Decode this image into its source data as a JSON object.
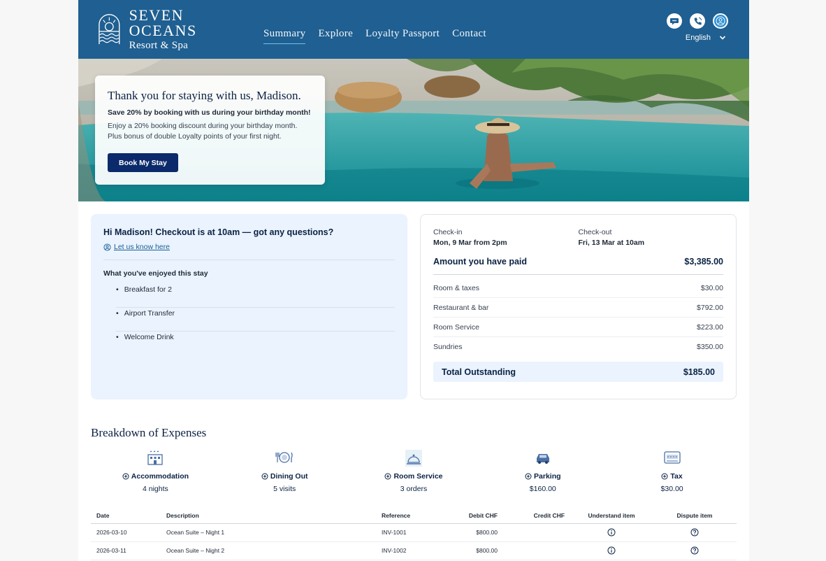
{
  "brand": {
    "name": "SEVEN OCEANS",
    "tagline": "Resort & Spa"
  },
  "nav": {
    "items": [
      {
        "label": "Summary",
        "active": true
      },
      {
        "label": "Explore"
      },
      {
        "label": "Loyalty Passport"
      },
      {
        "label": "Contact"
      }
    ]
  },
  "header": {
    "icons": [
      "chat-icon",
      "phone-icon",
      "account-icon"
    ],
    "language": "English"
  },
  "hero": {
    "title": "Thank you for staying with us, Madison.",
    "promo": "Save 20% by booking with us during your birthday month!",
    "desc_line1": "Enjoy a 20% booking discount during your birthday month.",
    "desc_line2": "Plus bonus of double Loyalty points of your first night.",
    "button": "Book My Stay"
  },
  "info": {
    "heading": "Hi Madison! Checkout is at 10am — got any questions?",
    "link": "Let us know here",
    "subheading": "What you've enjoyed this stay",
    "items": [
      "Breakfast for 2",
      "Airport Transfer",
      "Welcome Drink"
    ]
  },
  "payment": {
    "checkin_label": "Check-in",
    "checkin_value": "Mon, 9 Mar from 2pm",
    "checkout_label": "Check-out",
    "checkout_value": "Fri, 13 Mar at 10am",
    "paid_label": "Amount you have paid",
    "paid_value": "$3,385.00",
    "lines": [
      {
        "label": "Room & taxes",
        "value": "$30.00"
      },
      {
        "label": "Restaurant & bar",
        "value": "$792.00"
      },
      {
        "label": "Room Service",
        "value": "$223.00"
      },
      {
        "label": "Sundries",
        "value": "$350.00"
      }
    ],
    "total_label": "Total Outstanding",
    "total_value": "$185.00"
  },
  "breakdown": {
    "title": "Breakdown of Expenses",
    "categories": [
      {
        "name": "Accommodation",
        "value": "4 nights",
        "icon": "hotel-icon"
      },
      {
        "name": "Dining Out",
        "value": "5 visits",
        "icon": "dining-icon"
      },
      {
        "name": "Room Service",
        "value": "3 orders",
        "icon": "service-bell-icon"
      },
      {
        "name": "Parking",
        "value": "$160.00",
        "icon": "car-icon"
      },
      {
        "name": "Tax",
        "value": "$30.00",
        "icon": "receipt-icon"
      }
    ]
  },
  "table": {
    "columns": [
      "Date",
      "Description",
      "Reference",
      "Debit CHF",
      "Credit CHF",
      "Understand item",
      "Dispute item"
    ],
    "rows": [
      {
        "date": "2026-03-10",
        "description": "Ocean Suite – Night 1",
        "reference": "INV-1001",
        "debit": "$800.00",
        "credit": ""
      },
      {
        "date": "2026-03-11",
        "description": "Ocean Suite – Night 2",
        "reference": "INV-1002",
        "debit": "$800.00",
        "credit": ""
      }
    ]
  },
  "colors": {
    "header": "#1f5f91",
    "navy": "#0b2243",
    "button": "#0b2a6b",
    "panel": "#eaf3fe",
    "accent": "#6fc4ec"
  }
}
